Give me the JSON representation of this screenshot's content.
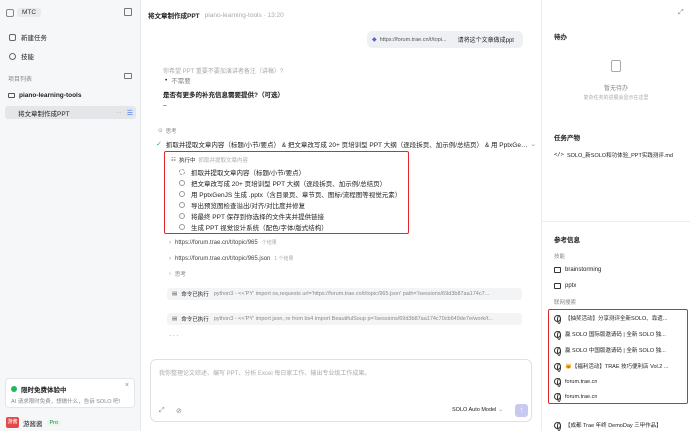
{
  "sidebar": {
    "workspace": "MTC",
    "new_task": "新建任务",
    "skills": "技能",
    "project_list": "项目列表",
    "project_name": "piano-learning-tools",
    "active_task": "将文章制作成PPT",
    "promo_title": "限时免费体验中",
    "promo_text": "AI 请求限时免费，想做什么，告诉 SOLO 吧!",
    "user_avatar": "游酱",
    "user_name": "游酱酱",
    "badge": "Pro"
  },
  "header": {
    "title": "将文章制作成PPT",
    "subtitle": "piano-learning-tools · 13:20"
  },
  "chat": {
    "user_bubble_url": "https://forum.trae.cn/t/topi...",
    "user_bubble_text": "请将这个文章做成ppt",
    "faded_line": "你希望 PPT 重要不要加演讲者备注（讲稿）?",
    "not_needed": "不需要",
    "question": "是否有更多的补充信息需要提供?（可选）",
    "dash": "–",
    "thinking1": "思考",
    "task_summary": "抓取并提取文章内容（标题/小节/要点） & 把文章改写成 20+ 页培训型 PPT 大纲（逐段拆页、加示例/总结页） & 用 PptxGenJ...",
    "exec_label": "执行中",
    "exec_detail": "抓取并提取文章内容",
    "tasks": [
      "抓取并提取文章内容（标题/小节/要点）",
      "把文章改写成 20+ 页培训型 PPT 大纲（逐段拆页、加示例/总结页）",
      "用 PptxGenJS 生成 .pptx（含目录页、章节页、图标/流程图等视觉元素）",
      "导出预览图检查溢出/对齐/对比度并修复",
      "将最终 PPT 保存到你选择的文件夹并提供链接",
      "生成 PPT 视觉设计系统（配色/字体/版式结构）"
    ],
    "link1": "https://forum.trae.cn/t/topic/965",
    "link1_meta": "个结果",
    "link2": "https://forum.trae.cn/t/topic/965.json",
    "link2_meta": "1 个结果",
    "thinking2": "思考",
    "cmd_label": "命令已执行",
    "cmd1": "python3 - <<'PY' import os,requests url='https://forum.trae.cn/t/topic/965.json' path='/sessions/69d3b87aa174c7...",
    "cmd2": "python3 - <<'PY' import json, re from bs4 import BeautifulSoup p='/sessions/69d3b87aa174c70cb649de7e/work/t..."
  },
  "composer": {
    "placeholder": "我你整理论文综述、编写 PPT、分析 Excel 每日家工作、输出专业级工作成果。",
    "model": "SOLO Auto Model"
  },
  "right": {
    "todo_title": "待办",
    "todo_empty": "暂无待办",
    "todo_hint": "复杂任务的进展会显示在这里",
    "artifacts_title": "任务产物",
    "artifact_file": "SOLO_新SOLO和功体验_PPT实践测评.md",
    "refs_title": "参考信息",
    "skills_label": "技能",
    "skills": [
      "brainstorming",
      "pptx"
    ],
    "web_label": "联网搜索",
    "web_results": [
      "【抽奖活动】分享测评全新SOLO、靠遗...",
      "赢 SOLO 国际版邀请码 | 全新 SOLO 独...",
      "赢 SOLO 中国版邀请码 | 全新 SOLO 独...",
      "🐱【福利活动】TRAE 技巧便利店 Vol.2 ...",
      "forum.trae.cn",
      "forum.trae.cn",
      "【成都 Trae 年终 DemoDay 三甲作品】"
    ]
  }
}
